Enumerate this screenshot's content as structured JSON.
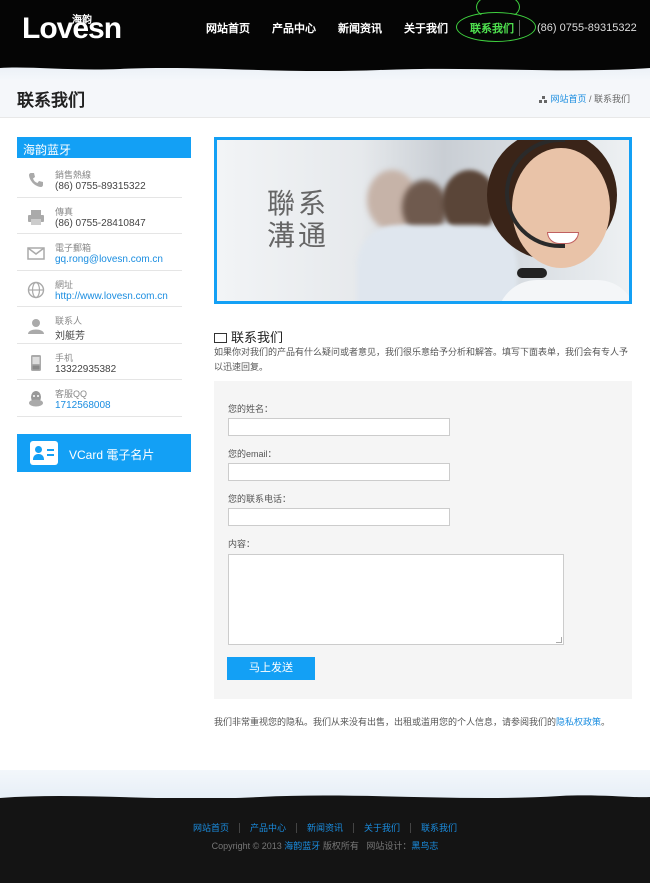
{
  "header": {
    "logo_text": "Lovesn",
    "logo_cn": "海韵",
    "nav": [
      "网站首页",
      "产品中心",
      "新闻资讯",
      "关于我们",
      "联系我们"
    ],
    "phone": "(86) 0755-89315322"
  },
  "page": {
    "title": "联系我们",
    "breadcrumb_home": "网站首页",
    "breadcrumb_sep": " / ",
    "breadcrumb_current": "联系我们"
  },
  "sidebar": {
    "heading": "海韵蓝牙",
    "items": [
      {
        "icon": "phone-icon",
        "label": "銷售熱線",
        "value": "(86) 0755-89315322"
      },
      {
        "icon": "fax-icon",
        "label": "傳真",
        "value": "(86) 0755-28410847"
      },
      {
        "icon": "mail-icon",
        "label": "電子郵箱",
        "value": "gq.rong@lovesn.com.cn"
      },
      {
        "icon": "globe-icon",
        "label": "網址",
        "value": "http://www.lovesn.com.cn"
      },
      {
        "icon": "person-icon",
        "label": "联系人",
        "value": "刘艇芳"
      },
      {
        "icon": "mobile-icon",
        "label": "手机",
        "value": "13322935382"
      },
      {
        "icon": "qq-icon",
        "label": "客服QQ",
        "value": "1712568008"
      }
    ],
    "vcard_label": "VCard 電子名片"
  },
  "banner": {
    "line1": "聯系",
    "line2": "溝通"
  },
  "form_section": {
    "title": "联系我们",
    "description": "如果你对我们的产品有什么疑问或者意见，我们很乐意给予分析和解答。填写下面表单，我们会有专人予以迅速回复。",
    "name_label": "您的姓名：",
    "email_label": "您的email：",
    "phone_label": "您的联系电话：",
    "content_label": "内容：",
    "submit_label": "马上发送",
    "privacy_text": "我们非常重视您的隐私。我们从来没有出售，出租或滥用您的个人信息，请参阅我们的",
    "privacy_link": "隐私权政策",
    "privacy_end": "。"
  },
  "footer": {
    "nav": [
      "网站首页",
      "产品中心",
      "新闻资讯",
      "关于我们",
      "联系我们"
    ],
    "copyright_prefix": "Copyright © 2013",
    "copyright_brand": "海韵蓝牙",
    "copyright_rights": "版权所有",
    "design_label": "网站设计：",
    "designer": "黑鸟志"
  },
  "colors": {
    "accent": "#13a0f5",
    "active_nav": "#4fe04f",
    "header_bg": "#050505"
  }
}
